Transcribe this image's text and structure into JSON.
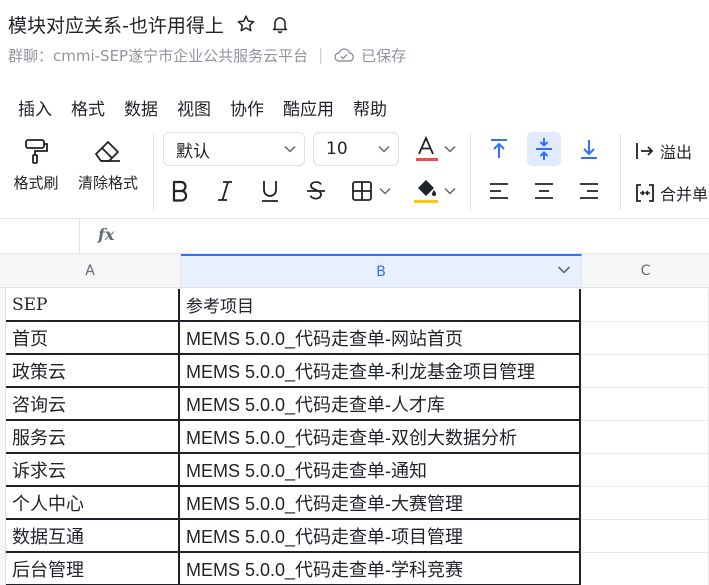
{
  "doc": {
    "title": "模块对应关系-也许用得上",
    "group_label": "群聊：cmmi-SEP遂宁市企业公共服务云平台",
    "separator": "|",
    "saved_label": "已保存"
  },
  "menu": {
    "items": [
      {
        "label": "插入"
      },
      {
        "label": "格式"
      },
      {
        "label": "数据"
      },
      {
        "label": "视图"
      },
      {
        "label": "协作"
      },
      {
        "label": "酷应用"
      },
      {
        "label": "帮助"
      }
    ]
  },
  "toolbar": {
    "format_painter_label": "格式刷",
    "clear_format_label": "清除格式",
    "font_family_value": "默认",
    "font_size_value": "10",
    "overflow_label": "溢出",
    "merge_label": "合并单"
  },
  "formula_bar": {
    "fx_label": "fx",
    "name_box_value": ""
  },
  "sheet": {
    "columns": [
      "A",
      "B",
      "C"
    ],
    "header_row": [
      "SEP",
      "参考项目"
    ],
    "rows": [
      [
        "首页",
        "MEMS 5.0.0_代码走查单-网站首页"
      ],
      [
        "政策云",
        "MEMS 5.0.0_代码走查单-利龙基金项目管理"
      ],
      [
        "咨询云",
        "MEMS 5.0.0_代码走查单-人才库"
      ],
      [
        "服务云",
        "MEMS 5.0.0_代码走查单-双创大数据分析"
      ],
      [
        "诉求云",
        "MEMS 5.0.0_代码走查单-通知"
      ],
      [
        "个人中心",
        "MEMS 5.0.0_代码走查单-大赛管理"
      ],
      [
        "数据互通",
        "MEMS 5.0.0_代码走查单-项目管理"
      ],
      [
        "后台管理",
        "MEMS 5.0.0_代码走查单-学科竞赛"
      ]
    ]
  },
  "colors": {
    "accent": "#3370ff",
    "font_color_underline": "#f54a45",
    "fill_color_underline": "#ffc60a"
  }
}
